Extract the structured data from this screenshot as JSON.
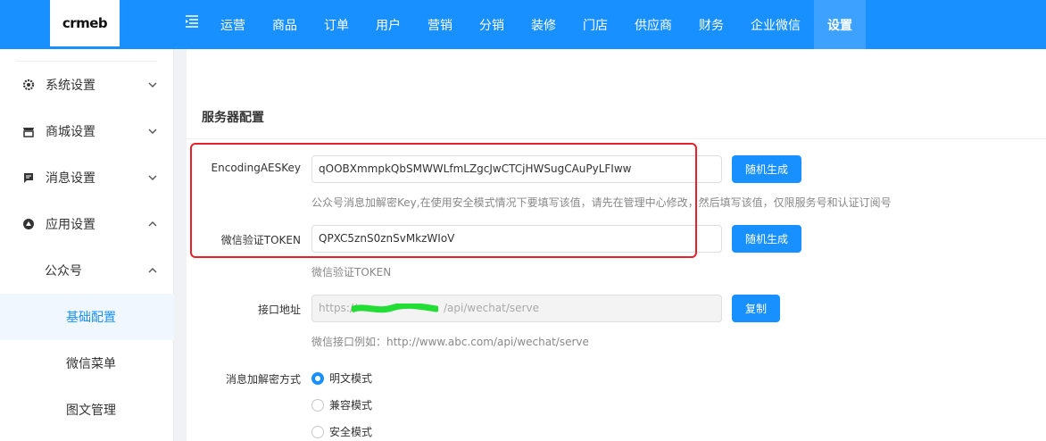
{
  "header": {
    "logo_text": "crmeb",
    "nav": [
      "运营",
      "商品",
      "订单",
      "用户",
      "营销",
      "分销",
      "装修",
      "门店",
      "供应商",
      "财务",
      "企业微信",
      "设置"
    ],
    "active_nav": "设置"
  },
  "sidebar": {
    "items": [
      {
        "label": "系统设置",
        "icon": "gear-icon"
      },
      {
        "label": "商城设置",
        "icon": "shop-icon"
      },
      {
        "label": "消息设置",
        "icon": "message-icon"
      },
      {
        "label": "应用设置",
        "icon": "app-icon"
      }
    ],
    "submenu": {
      "label": "公众号"
    },
    "leaves": [
      {
        "label": "基础配置",
        "active": true
      },
      {
        "label": "微信菜单",
        "active": false
      },
      {
        "label": "图文管理",
        "active": false
      }
    ]
  },
  "main": {
    "section_title": "服务器配置",
    "aes_key": {
      "label": "EncodingAESKey",
      "value": "qOOBXmmpkQbSMWWLfmLZgcJwCTCjHWSugCAuPyLFIww",
      "button": "随机生成",
      "hint": "公众号消息加解密Key,在使用安全模式情况下要填写该值，请先在管理中心修改，然后填写该值，仅限服务号和认证订阅号"
    },
    "token": {
      "label": "微信验证TOKEN",
      "value": "QPXC5znS0znSvMkzWIoV",
      "button": "随机生成",
      "hint": "微信验证TOKEN"
    },
    "endpoint": {
      "label": "接口地址",
      "value_prefix": "https://",
      "value_suffix": "/api/wechat/serve",
      "button": "复制",
      "hint": "微信接口例如：http://www.abc.com/api/wechat/serve"
    },
    "encryption": {
      "label": "消息加解密方式",
      "options": [
        "明文模式",
        "兼容模式",
        "安全模式"
      ],
      "selected": "明文模式"
    }
  },
  "colors": {
    "primary": "#1890ff",
    "highlight": "#e8202a"
  }
}
